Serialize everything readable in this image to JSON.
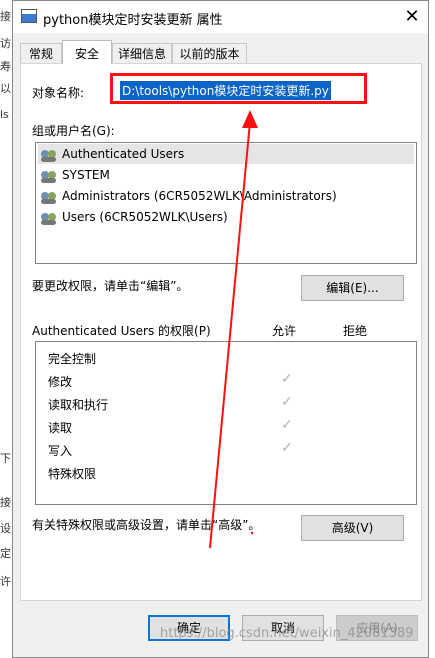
{
  "window": {
    "title": "python模块定时安装更新 属性",
    "close_glyph": "✕"
  },
  "background_left": {
    "chars": [
      "接",
      "访",
      "寿",
      "以",
      "ls",
      "下",
      "接",
      "设",
      "定",
      "许"
    ]
  },
  "tabs": [
    {
      "label": "常规",
      "active": false
    },
    {
      "label": "安全",
      "active": true
    },
    {
      "label": "详细信息",
      "active": false
    },
    {
      "label": "以前的版本",
      "active": false
    }
  ],
  "object": {
    "label": "对象名称:",
    "value": "D:\\tools\\python模块定时安装更新.py"
  },
  "groups": {
    "label": "组或用户名(G):",
    "items": [
      {
        "name": "Authenticated Users",
        "selected": true
      },
      {
        "name": "SYSTEM",
        "selected": false
      },
      {
        "name": "Administrators (6CR5052WLK\\Administrators)",
        "selected": false
      },
      {
        "name": "Users (6CR5052WLK\\Users)",
        "selected": false
      }
    ]
  },
  "change_hint": "要更改权限，请单击“编辑”。",
  "edit_button": "编辑(E)...",
  "permissions": {
    "header": "Authenticated Users 的权限(P)",
    "allow_header": "允许",
    "deny_header": "拒绝",
    "rows": [
      {
        "name": "完全控制",
        "allow": false
      },
      {
        "name": "修改",
        "allow": true
      },
      {
        "name": "读取和执行",
        "allow": true
      },
      {
        "name": "读取",
        "allow": true
      },
      {
        "name": "写入",
        "allow": true
      },
      {
        "name": "特殊权限",
        "allow": false
      }
    ],
    "check_glyph": "✓"
  },
  "advanced_hint": "有关特殊权限或高级设置，请单击“高级”。",
  "advanced_button": "高级(V)",
  "footer": {
    "ok": "确定",
    "cancel": "取消",
    "apply": "应用(A)"
  },
  "watermark": "https://blog.csdn.net/weixin_42081389",
  "colors": {
    "selection": "#0a64c8",
    "annotation": "#ff1010",
    "accent": "#0078d7"
  }
}
